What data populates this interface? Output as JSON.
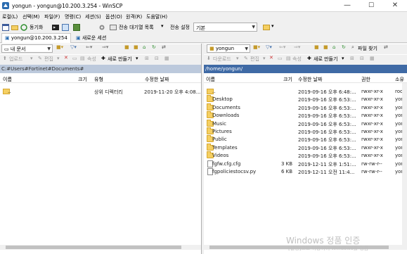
{
  "window": {
    "title": "yongun - yongun@10.200.3.254 - WinSCP",
    "minimize": "—",
    "maximize": "☐",
    "close": "✕"
  },
  "menu": [
    "로컬(L)",
    "선택(M)",
    "파일(F)",
    "명령(C)",
    "세션(S)",
    "옵션(O)",
    "원격(R)",
    "도움말(H)"
  ],
  "toolbar": {
    "sync_label": "동기화",
    "queue_label": "전송 대기열 목록",
    "transfer_settings_label": "전송 설정",
    "transfer_settings_value": "기본"
  },
  "tabs": [
    {
      "label": "yongun@10.200.3.254",
      "active": true
    },
    {
      "label": "새로운 세션",
      "active": false
    }
  ],
  "left_panel": {
    "drive": "내 문서",
    "upload_label": "업로드",
    "edit_label": "편집",
    "properties_label": "속성",
    "new_label": "새로 만들기",
    "path": "C:#Users#Fortinet#Documents#",
    "columns": [
      "이름",
      "크기",
      "유형",
      "수정한 날짜"
    ],
    "rows": [
      {
        "name": "..",
        "size": "",
        "type": "상위 디렉터리",
        "modified": "2019-11-20  오후 4:08..."
      }
    ]
  },
  "right_panel": {
    "folder": "yongun",
    "find_label": "파일 찾기",
    "download_label": "다운로드",
    "edit_label": "편집",
    "properties_label": "속성",
    "new_label": "새로 만들기",
    "path": "/home/yongun/",
    "columns": [
      "이름",
      "크기",
      "수정한 날짜",
      "권한",
      "소유"
    ],
    "rows": [
      {
        "icon": "up",
        "name": "..",
        "size": "",
        "modified": "2019-09-16  오후 6:48:...",
        "perm": "rwxr-xr-x",
        "owner": "root"
      },
      {
        "icon": "folder",
        "name": "Desktop",
        "size": "",
        "modified": "2019-09-16  오후 6:53:...",
        "perm": "rwxr-xr-x",
        "owner": "yong"
      },
      {
        "icon": "folder",
        "name": "Documents",
        "size": "",
        "modified": "2019-09-16  오후 6:53:...",
        "perm": "rwxr-xr-x",
        "owner": "yong"
      },
      {
        "icon": "folder",
        "name": "Downloads",
        "size": "",
        "modified": "2019-09-16  오후 6:53:...",
        "perm": "rwxr-xr-x",
        "owner": "yong"
      },
      {
        "icon": "folder",
        "name": "Music",
        "size": "",
        "modified": "2019-09-16  오후 6:53:...",
        "perm": "rwxr-xr-x",
        "owner": "yong"
      },
      {
        "icon": "folder",
        "name": "Pictures",
        "size": "",
        "modified": "2019-09-16  오후 6:53:...",
        "perm": "rwxr-xr-x",
        "owner": "yong"
      },
      {
        "icon": "folder",
        "name": "Public",
        "size": "",
        "modified": "2019-09-16  오후 6:53:...",
        "perm": "rwxr-xr-x",
        "owner": "yong"
      },
      {
        "icon": "folder",
        "name": "Templates",
        "size": "",
        "modified": "2019-09-16  오후 6:53:...",
        "perm": "rwxr-xr-x",
        "owner": "yong"
      },
      {
        "icon": "folder",
        "name": "Videos",
        "size": "",
        "modified": "2019-09-16  오후 6:53:...",
        "perm": "rwxr-xr-x",
        "owner": "yong"
      },
      {
        "icon": "file",
        "name": "fgfw.cfg.cfg",
        "size": "3 KB",
        "modified": "2019-12-11  오후 1:51:...",
        "perm": "rw-rw-r--",
        "owner": "yong"
      },
      {
        "icon": "file",
        "name": "fgpoliciestocsv.py",
        "size": "6 KB",
        "modified": "2019-12-11  오전 11:4...",
        "perm": "rw-rw-r--",
        "owner": "yong"
      }
    ]
  },
  "watermark": {
    "line1": "Windows 정품 인증",
    "line2": "[설정]으로 이동하여 Windows를 정품"
  }
}
